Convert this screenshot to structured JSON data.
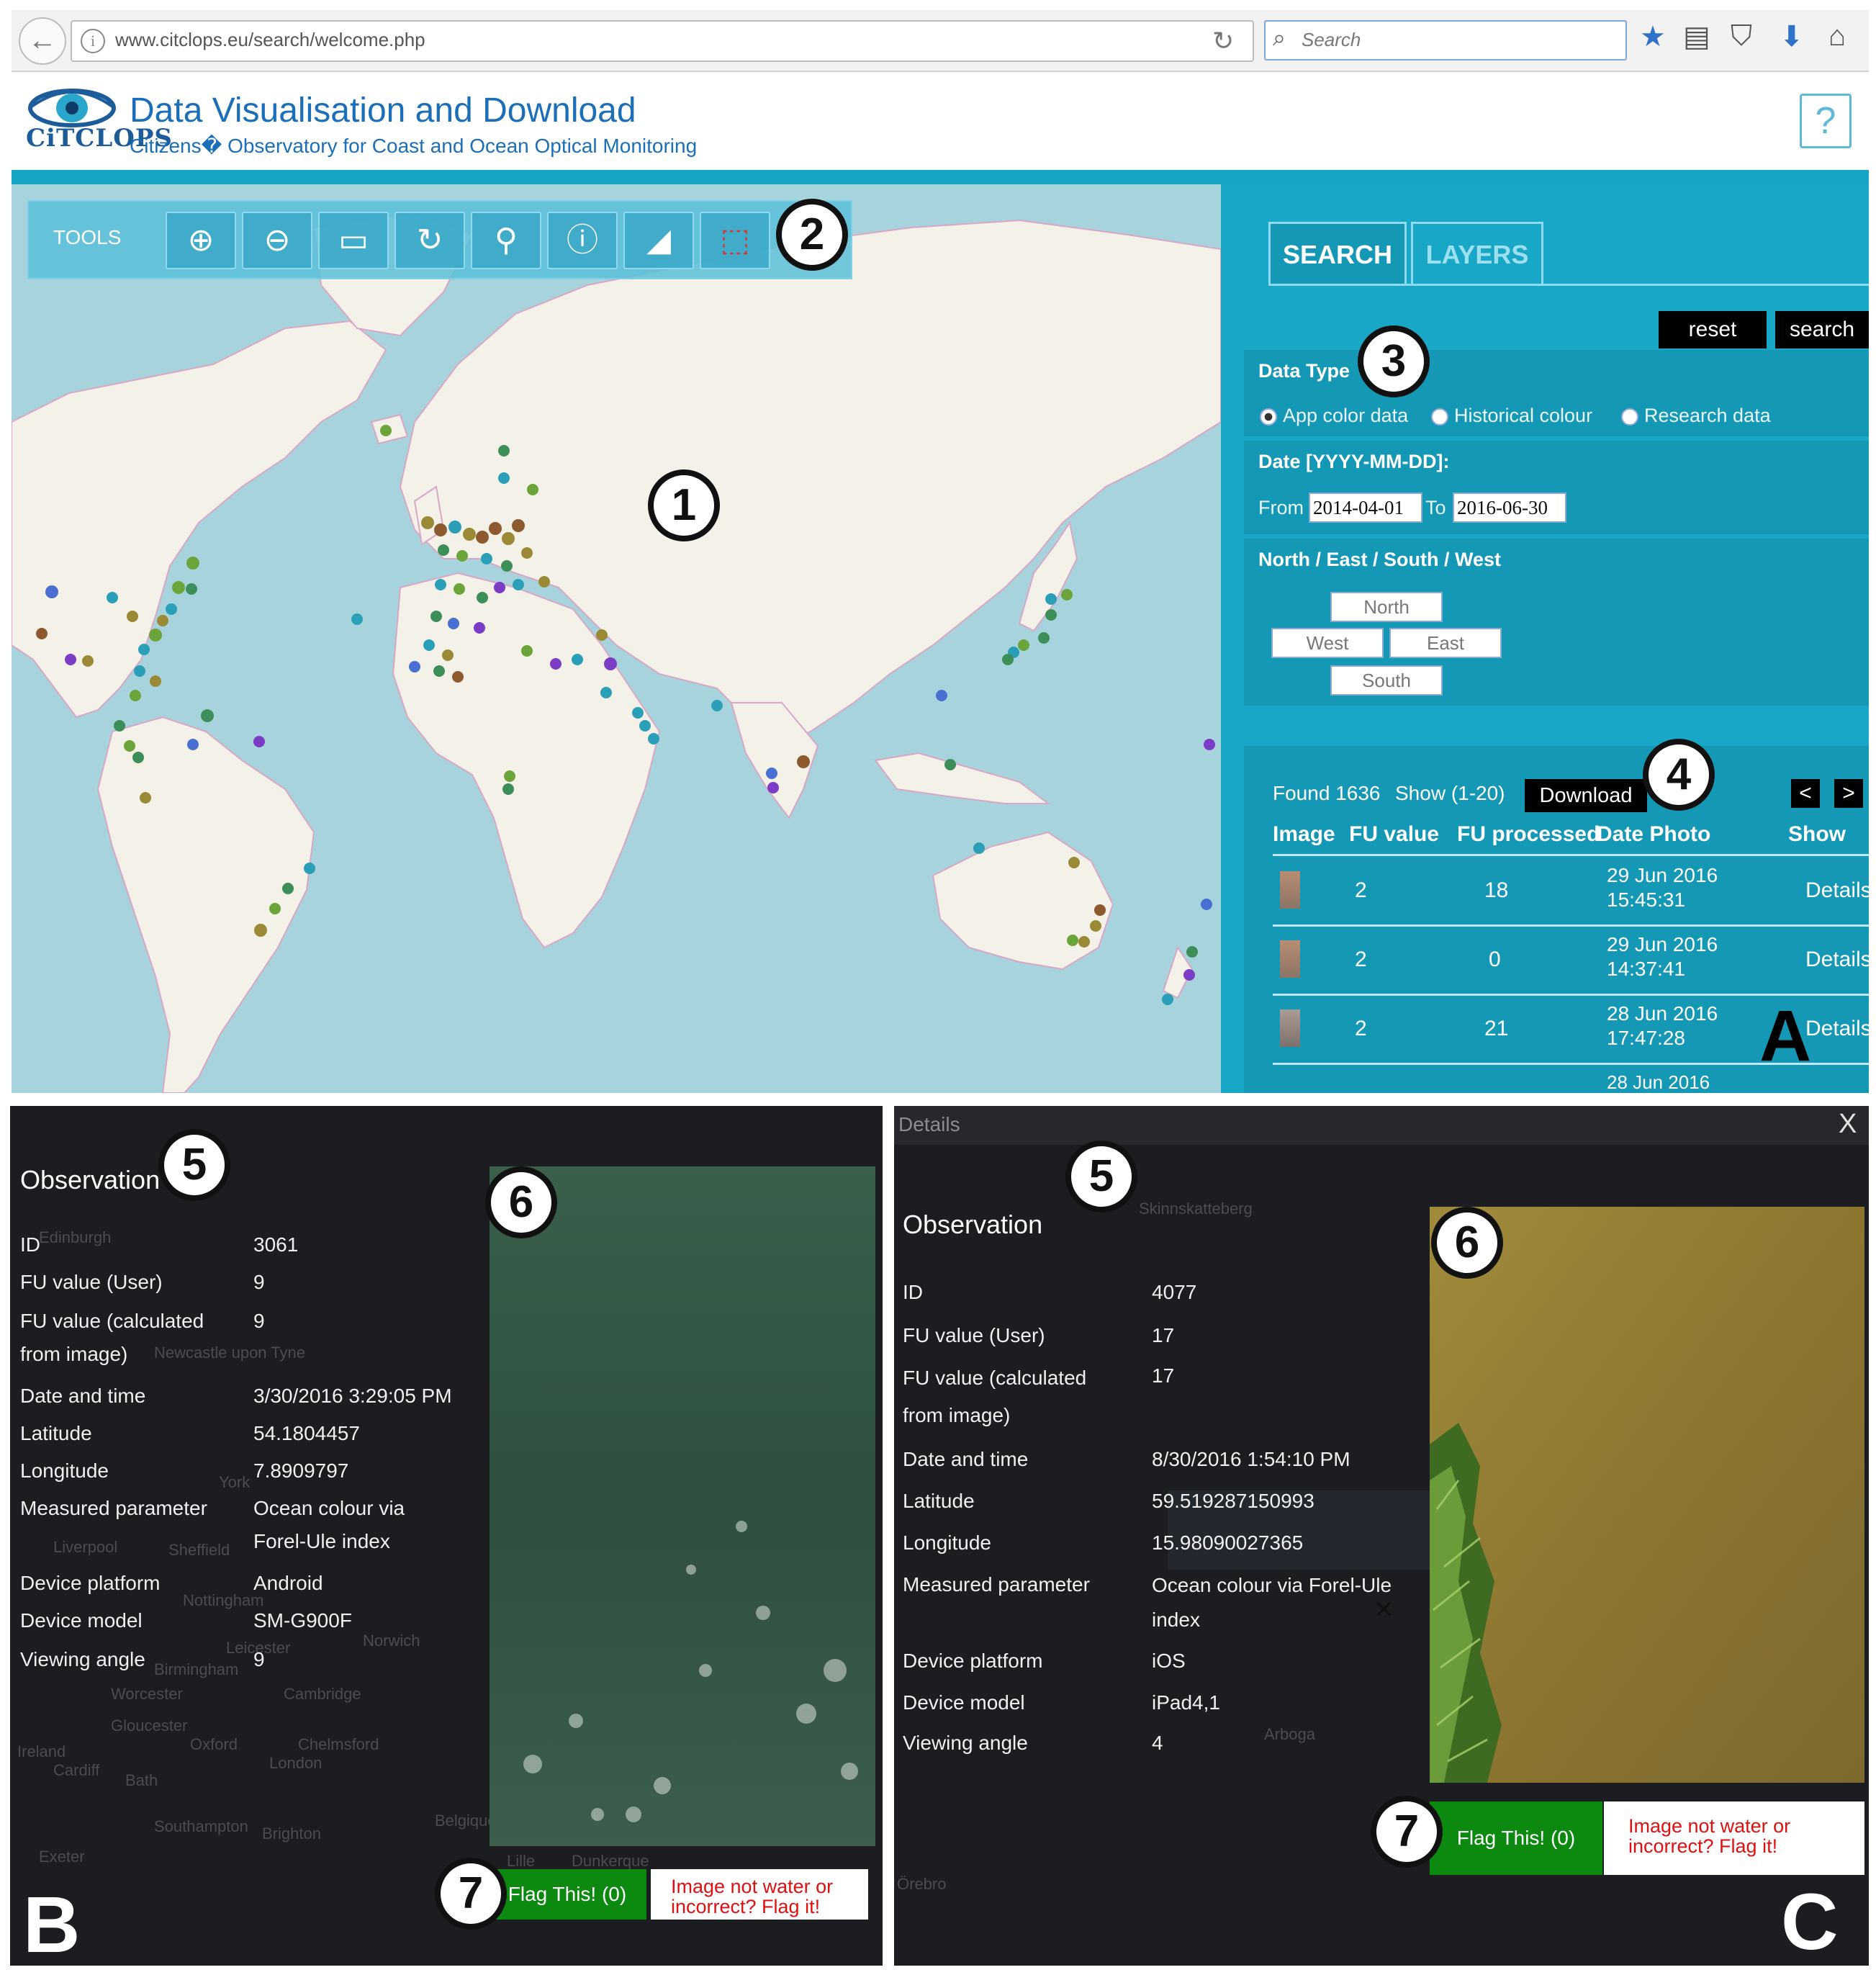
{
  "browser": {
    "url": "www.citclops.eu/search/welcome.php",
    "search_placeholder": "Search",
    "icons": [
      "back-arrow-icon",
      "info-icon",
      "reload-icon",
      "search-icon",
      "bookmark-star-icon",
      "reading-list-icon",
      "pocket-icon",
      "download-icon",
      "home-icon"
    ]
  },
  "site": {
    "logo_text": "CiTCLOPS",
    "title": "Data Visualisation and Download",
    "subtitle": "Citizens� Observatory for Coast and Ocean Optical Monitoring",
    "help_label": "?"
  },
  "map": {
    "tools_label": "TOOLS",
    "tools": [
      {
        "name": "zoom-in-icon",
        "glyph": "⊕"
      },
      {
        "name": "zoom-out-icon",
        "glyph": "⊖"
      },
      {
        "name": "box-select-icon",
        "glyph": "▭"
      },
      {
        "name": "rotate-icon",
        "glyph": "↻"
      },
      {
        "name": "location-pin-icon",
        "glyph": "⬤"
      },
      {
        "name": "info-icon",
        "glyph": "ⓘ"
      },
      {
        "name": "measure-icon",
        "glyph": "◢"
      },
      {
        "name": "select-area-icon",
        "glyph": "⬚"
      }
    ],
    "badges": {
      "one": "1",
      "two": "2"
    },
    "colors": {
      "ocean": "#a7d4dc",
      "land": "#f4f1e8",
      "border": "#d9a7c6",
      "point_colors": [
        "#2a9fb7",
        "#3d8f5a",
        "#6aa43a",
        "#9a8a35",
        "#8c5a2e",
        "#7b3cc6",
        "#4a6fd2"
      ]
    }
  },
  "panel": {
    "tabs": [
      "SEARCH",
      "LAYERS"
    ],
    "reset_label": "reset",
    "search_label": "search",
    "badge_three": "3",
    "data_type": {
      "title": "Data Type",
      "options": [
        {
          "label": "App color data",
          "selected": true
        },
        {
          "label": "Historical colour",
          "selected": false
        },
        {
          "label": "Research data",
          "selected": false
        }
      ]
    },
    "date": {
      "title": "Date [YYYY-MM-DD]:",
      "from_label": "From",
      "from_value": "2014-04-01",
      "to_label": "To",
      "to_value": "2016-06-30"
    },
    "bounds": {
      "title": "North / East / South / West",
      "north": "North",
      "west": "West",
      "east": "East",
      "south": "South"
    },
    "results": {
      "found": "Found 1636",
      "show": "Show (1-20)",
      "download_label": "Download",
      "badge_four": "4",
      "prev": "<",
      "next": ">",
      "headers": [
        "Image",
        "FU value",
        "FU processed",
        "Date Photo",
        "Show"
      ],
      "rows": [
        {
          "fu": "2",
          "processed": "18",
          "date": "29 Jun 2016",
          "time": "15:45:31",
          "action": "Details"
        },
        {
          "fu": "2",
          "processed": "0",
          "date": "29 Jun 2016",
          "time": "14:37:41",
          "action": "Details"
        },
        {
          "fu": "2",
          "processed": "21",
          "date": "28 Jun 2016",
          "time": "17:47:28",
          "action": "Details"
        }
      ],
      "partial_row": "28 Jun 2016"
    },
    "panel_letter": "A"
  },
  "panelB": {
    "letter": "B",
    "badges": {
      "five": "5",
      "six": "6",
      "seven": "7"
    },
    "title": "Observation",
    "fields": [
      {
        "label": "ID",
        "value": "3061"
      },
      {
        "label": "FU value (User)",
        "value": "9"
      },
      {
        "label": "FU value (calculated from image)",
        "value": "9"
      },
      {
        "label": "Date and time",
        "value": "3/30/2016 3:29:05 PM"
      },
      {
        "label": "Latitude",
        "value": "54.1804457"
      },
      {
        "label": "Longitude",
        "value": "7.8909797"
      },
      {
        "label": "Measured parameter",
        "value": "Ocean colour via Forel-Ule index"
      },
      {
        "label": "Device platform",
        "value": "Android"
      },
      {
        "label": "Device model",
        "value": "SM-G900F"
      },
      {
        "label": "Viewing angle",
        "value": "9"
      }
    ],
    "ghost_labels": [
      "Edinburgh",
      "Newcastle upon Tyne",
      "York",
      "Liverpool",
      "Sheffield",
      "Nottingham",
      "Leicester",
      "Norwich",
      "Birmingham",
      "Worcester",
      "Cambridge",
      "Gloucester",
      "Oxford",
      "Chelmsford",
      "Cardiff",
      "Bath",
      "London",
      "Southampton",
      "Brighton",
      "Exeter",
      "Lille",
      "Dunkerque",
      "Ireland",
      "Belgique"
    ],
    "flag_button": "Flag This! (0)",
    "flag_note": "Image not water or incorrect? Flag it!"
  },
  "panelC": {
    "letter": "C",
    "header": "Details",
    "close": "X",
    "badges": {
      "five": "5",
      "six": "6",
      "seven": "7"
    },
    "title": "Observation",
    "fields": [
      {
        "label": "ID",
        "value": "4077"
      },
      {
        "label": "FU value (User)",
        "value": "17"
      },
      {
        "label": "FU value (calculated from image)",
        "value": "17"
      },
      {
        "label": "Date and time",
        "value": "8/30/2016 1:54:10 PM"
      },
      {
        "label": "Latitude",
        "value": "59.519287150993"
      },
      {
        "label": "Longitude",
        "value": "15.98090027365"
      },
      {
        "label": "Measured parameter",
        "value": "Ocean colour via Forel-Ule index"
      },
      {
        "label": "Device platform",
        "value": "iOS"
      },
      {
        "label": "Device model",
        "value": "iPad4,1"
      },
      {
        "label": "Viewing angle",
        "value": "4"
      }
    ],
    "ghost_labels": [
      "Skinnskatteberg",
      "Arboga",
      "Örebro"
    ],
    "flag_button": "Flag This! (0)",
    "flag_note": "Image not water or incorrect? Flag it!"
  }
}
